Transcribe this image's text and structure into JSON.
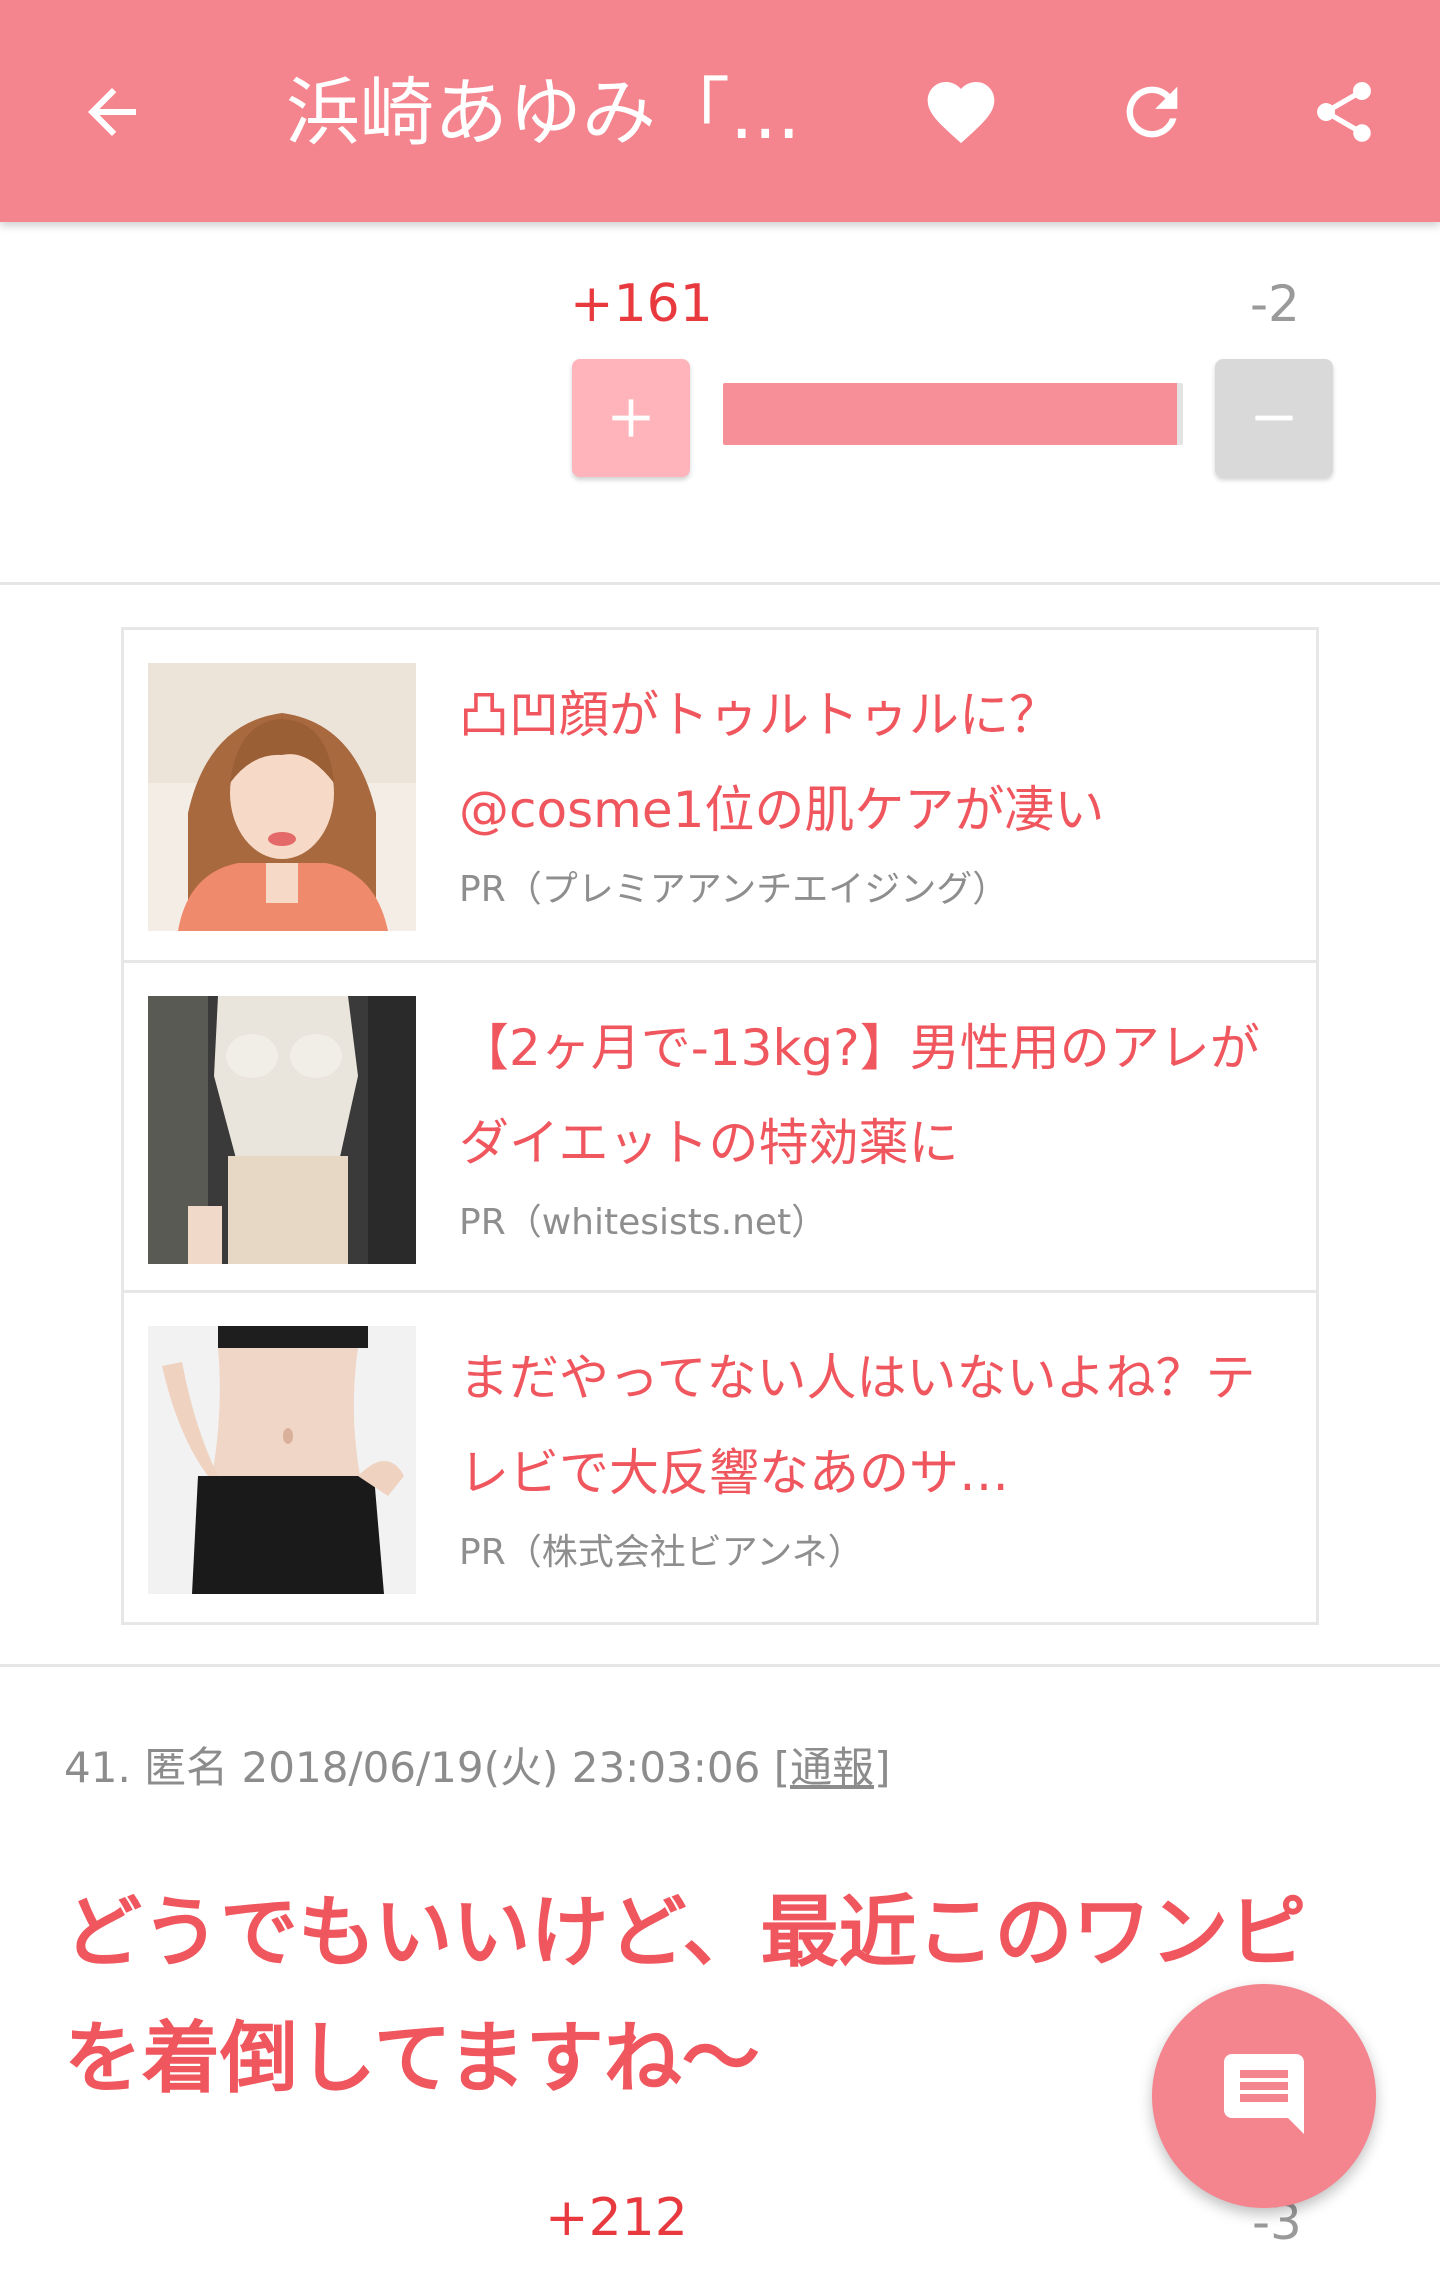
{
  "header": {
    "title": "浜崎あゆみ「...",
    "back_icon": "arrow-left-icon",
    "favorite_icon": "heart-icon",
    "refresh_icon": "refresh-icon",
    "share_icon": "share-icon",
    "color": "#f4848d"
  },
  "vote_1": {
    "plus_count": "+161",
    "minus_count": "-2",
    "plus_label": "+",
    "minus_label": "−",
    "positive_ratio": 0.988
  },
  "ads": [
    {
      "title": "凸凹顔がトゥルトゥルに？@cosme1位の肌ケアが凄い",
      "source": "PR（プレミアアンチエイジング）",
      "image": "woman-portrait-photo"
    },
    {
      "title": "【2ヶ月で-13kg?】男性用のアレがダイエットの特効薬に",
      "source": "PR（whitesists.net）",
      "image": "woman-in-knit-dress-photo"
    },
    {
      "title": "まだやってない人はいないよね？テレビで大反響なあのサ…",
      "source": "PR（株式会社ビアンネ）",
      "image": "slim-waist-photo"
    }
  ],
  "comment": {
    "number": "41.",
    "author": "匿名",
    "timestamp": "2018/06/19(火) 23:03:06",
    "report_label": "[通報]",
    "body": "どうでもいいけど、最近このワンピを着倒してますね〜"
  },
  "vote_2": {
    "plus_count": "+212",
    "minus_count": "-3"
  },
  "fab": {
    "icon": "comment-icon"
  },
  "colors": {
    "accent": "#f4848d",
    "plus_red": "#e8393f",
    "link_pink": "#f0565e"
  }
}
